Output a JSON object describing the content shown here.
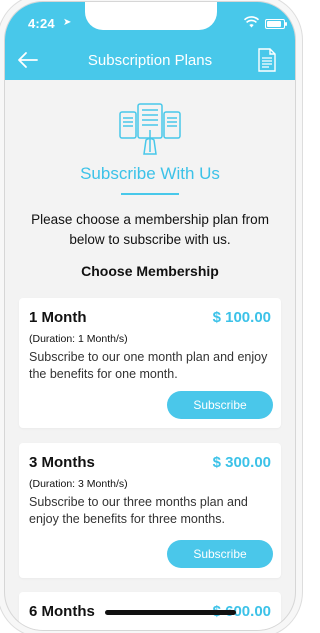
{
  "status_bar": {
    "time": "4:24",
    "location_glyph": "➤"
  },
  "app_bar": {
    "title": "Subscription Plans",
    "back_icon": "arrow-left-icon",
    "action_icon": "document-icon"
  },
  "header": {
    "heading": "Subscribe With Us",
    "intro": "Please choose a membership plan from below to subscribe with us.",
    "choose_label": "Choose Membership"
  },
  "plans": [
    {
      "name": "1 Month",
      "price": "$ 100.00",
      "duration": "(Duration: 1 Month/s)",
      "description": "Subscribe to our one month plan and enjoy the benefits for one month.",
      "button": "Subscribe"
    },
    {
      "name": "3 Months",
      "price": "$ 300.00",
      "duration": "(Duration: 3 Month/s)",
      "description": "Subscribe to our three months plan and enjoy the benefits for three months.",
      "button": "Subscribe"
    },
    {
      "name": "6 Months",
      "price": "$ 600.00"
    }
  ],
  "colors": {
    "accent": "#48c8ea",
    "background": "#f3f3f3",
    "card": "#ffffff"
  }
}
